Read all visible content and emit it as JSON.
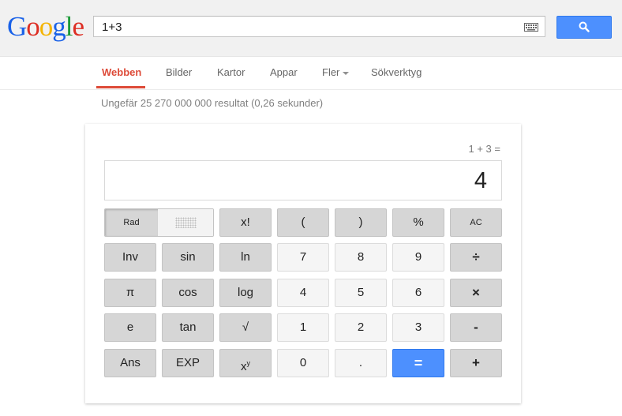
{
  "logo": {
    "letters": [
      "G",
      "o",
      "o",
      "g",
      "l",
      "e"
    ],
    "colors": [
      "#1a62e8",
      "#dd2e24",
      "#f4b400",
      "#1a62e8",
      "#1d9b3a",
      "#dd2e24"
    ]
  },
  "search": {
    "query": "1+3"
  },
  "nav": {
    "tabs": [
      "Webben",
      "Bilder",
      "Kartor",
      "Appar",
      "Fler",
      "Sökverktyg"
    ],
    "active": "Webben"
  },
  "result_stats": "Ungefär 25 270 000 000 resultat (0,26 sekunder)",
  "calculator": {
    "expression": "1 + 3 =",
    "display": "4",
    "rad_label": "Rad",
    "keys": {
      "fact": "x!",
      "lparen": "(",
      "rparen": ")",
      "percent": "%",
      "ac": "AC",
      "inv": "Inv",
      "sin": "sin",
      "ln": "ln",
      "n7": "7",
      "n8": "8",
      "n9": "9",
      "divide": "÷",
      "pi": "π",
      "cos": "cos",
      "log": "log",
      "n4": "4",
      "n5": "5",
      "n6": "6",
      "multiply": "×",
      "e": "e",
      "tan": "tan",
      "sqrt": "√",
      "n1": "1",
      "n2": "2",
      "n3": "3",
      "minus": "-",
      "ans": "Ans",
      "exp": "EXP",
      "pow_base": "x",
      "pow_exp": "y",
      "n0": "0",
      "dot": ".",
      "equals": "=",
      "plus": "+"
    }
  },
  "colors": {
    "accent_red": "#dd4b39",
    "search_blue": "#4d90fe"
  }
}
